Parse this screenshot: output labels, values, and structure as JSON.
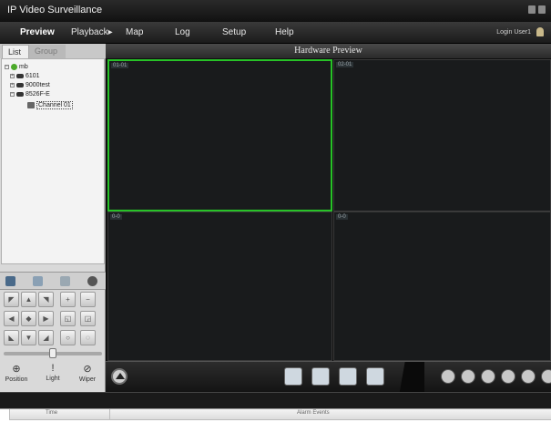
{
  "window": {
    "title": "IP Video Surveillance"
  },
  "menu": {
    "items": [
      {
        "label": "Preview"
      },
      {
        "label": "Playback▸"
      },
      {
        "label": "Map"
      },
      {
        "label": "Log"
      },
      {
        "label": "Setup"
      },
      {
        "label": "Help"
      }
    ],
    "login": "Login User1"
  },
  "left_panel": {
    "tabs": [
      {
        "label": "List"
      },
      {
        "label": "Group"
      }
    ],
    "tree": [
      {
        "label": "mb",
        "icon": "root-green-icon"
      },
      {
        "label": "6101",
        "icon": "dvr-icon"
      },
      {
        "label": "9000test",
        "icon": "dvr-icon"
      },
      {
        "label": "8526F-E",
        "icon": "dvr-icon"
      },
      {
        "label": "Channel 01",
        "icon": "camera-icon"
      }
    ],
    "lens": [
      {
        "label": "Position"
      },
      {
        "label": "Light"
      },
      {
        "label": "Wiper"
      }
    ]
  },
  "preview": {
    "title": "Hardware Preview",
    "cells": [
      {
        "label": "01-01"
      },
      {
        "label": "02-01"
      },
      {
        "label": "0-0"
      },
      {
        "label": "0-0"
      }
    ]
  },
  "alarm": {
    "col_time": "Time",
    "col_events": "Alarm Events"
  },
  "colors": {
    "selected_border": "#27c227",
    "background_dark": "#191b1c"
  }
}
